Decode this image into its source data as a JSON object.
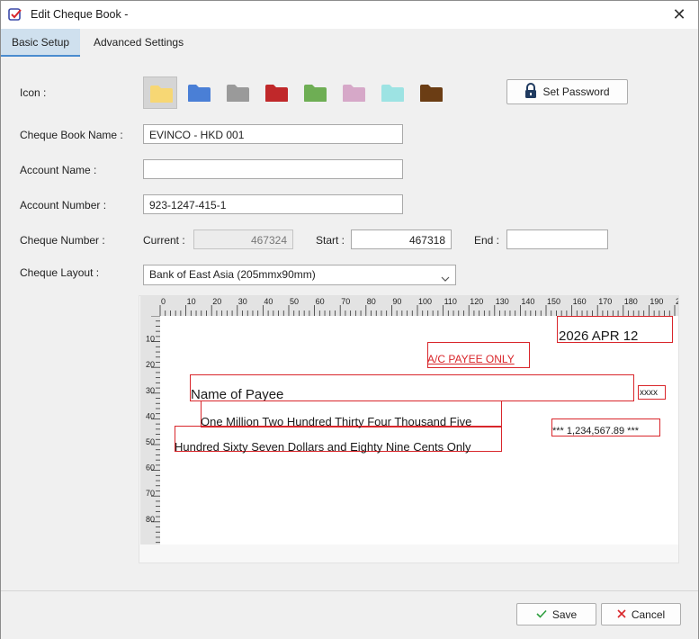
{
  "window": {
    "title": "Edit Cheque Book -"
  },
  "tabs": [
    {
      "label": "Basic Setup"
    },
    {
      "label": "Advanced Settings"
    }
  ],
  "form": {
    "icon_label": "Icon :",
    "icon_colors": [
      "#f7d774",
      "#4a7fd6",
      "#9a9a9a",
      "#c0282a",
      "#6fae55",
      "#d6a8c8",
      "#9de3e3",
      "#6b3d14"
    ],
    "set_password_label": "Set Password",
    "cheque_book_name_label": "Cheque Book Name :",
    "cheque_book_name_value": "EVINCO - HKD 001",
    "account_name_label": "Account Name :",
    "account_name_value": "",
    "account_number_label": "Account Number :",
    "account_number_value": "923-1247-415-1",
    "cheque_number_label": "Cheque Number :",
    "current_label": "Current :",
    "current_value": "467324",
    "start_label": "Start :",
    "start_value": "467318",
    "end_label": "End :",
    "end_value": "",
    "cheque_layout_label": "Cheque Layout :",
    "cheque_layout_value": "Bank of East Asia (205mmx90mm)"
  },
  "preview": {
    "ruler_top_labels": [
      "0",
      "10",
      "20",
      "30",
      "40",
      "50",
      "60",
      "70",
      "80",
      "90",
      "100",
      "110",
      "120",
      "130",
      "140",
      "150",
      "160",
      "170",
      "180",
      "190",
      "20"
    ],
    "ruler_left_labels": [
      "0",
      "10",
      "20",
      "30",
      "40",
      "50",
      "60",
      "70",
      "80"
    ],
    "date_text": "2026 APR 12",
    "crossing_text": "A/C PAYEE ONLY",
    "payee_text": "Name of Payee",
    "xxxx_text": "xxxx",
    "amount_words_line1": "One Million Two Hundred Thirty Four Thousand Five",
    "amount_words_line2": "Hundred Sixty Seven Dollars and Eighty Nine Cents Only",
    "amount_figures": "*** 1,234,567.89 ***"
  },
  "footer": {
    "save_label": "Save",
    "cancel_label": "Cancel"
  },
  "colors": {
    "accent": "#4a8ccf",
    "field_box": "#d9262b",
    "save_check": "#2e9e3e",
    "cancel_x": "#d9262b"
  }
}
